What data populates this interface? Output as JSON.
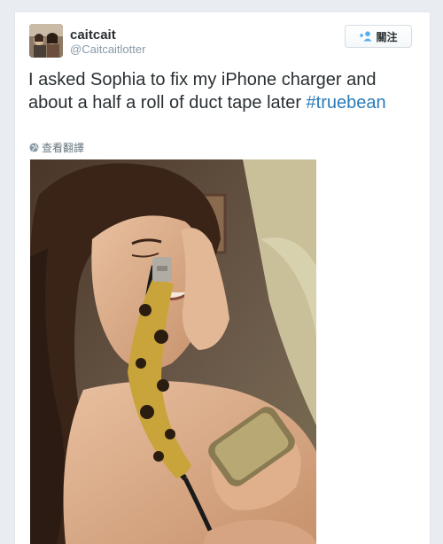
{
  "tweet": {
    "display_name": "caitcait",
    "screen_name": "@Caitcaitlotter",
    "follow_label": "關注",
    "text_main": "I asked Sophia to fix my iPhone charger and about a half a roll of duct tape later ",
    "hashtag": "#truebean",
    "translate_label": "查看翻譯"
  },
  "icons": {
    "avatar": "avatar-photo",
    "follow": "add-user-icon",
    "translate": "globe-icon",
    "photo": "tweet-photo"
  },
  "colors": {
    "link": "#2b7bb9",
    "text": "#292f33",
    "secondary": "#8899a6"
  }
}
